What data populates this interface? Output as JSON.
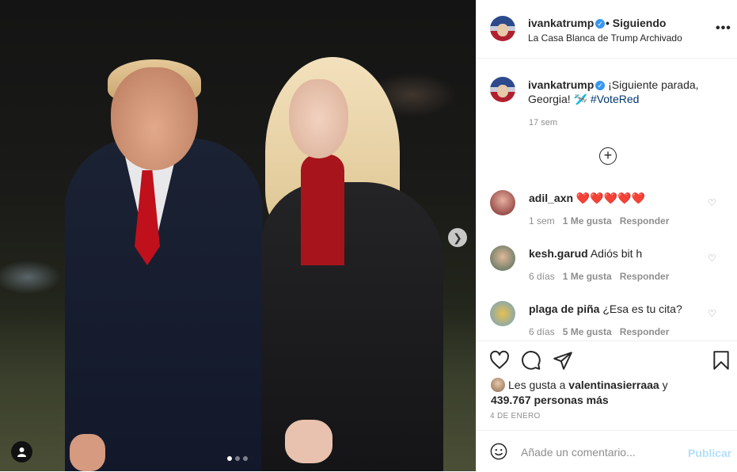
{
  "header": {
    "username": "ivankatrump",
    "follow_status": "• Siguiendo",
    "location": "La Casa Blanca de Trump Archivado",
    "more_label": "•••"
  },
  "caption": {
    "username": "ivankatrump",
    "text": "¡Siguiente parada, Georgia!",
    "emoji": "🛩️",
    "hashtag": "#VoteRed",
    "time": "17 sem"
  },
  "comments": [
    {
      "username": "adil_axn",
      "text": "❤️❤️❤️❤️❤️",
      "time": "1 sem",
      "likes": "1 Me gusta",
      "reply": "Responder",
      "avatar_color": "#7a2a2a"
    },
    {
      "username": "kesh.garud",
      "text": "Adiós bit h",
      "time": "6 días",
      "likes": "1 Me gusta",
      "reply": "Responder",
      "avatar_color": "#4a6a5a"
    },
    {
      "username": "plaga de piña",
      "text": "¿Esa es tu cita?",
      "time": "6 días",
      "likes": "5 Me gusta",
      "reply": "Responder",
      "avatar_color": "#6aa0c8"
    }
  ],
  "likes": {
    "prefix": "Les gusta a",
    "user": "valentinasierraaa",
    "conj": "y",
    "others": "439.767 personas más"
  },
  "date": "4 DE ENERO",
  "add_comment": {
    "placeholder": "Añade un comentario...",
    "publish": "Publicar"
  },
  "carousel": {
    "current_index": 1,
    "total": 3
  },
  "colors": {
    "verified": "#3897f0",
    "hashtag": "#00376b",
    "publish_disabled": "#b2dffc"
  }
}
